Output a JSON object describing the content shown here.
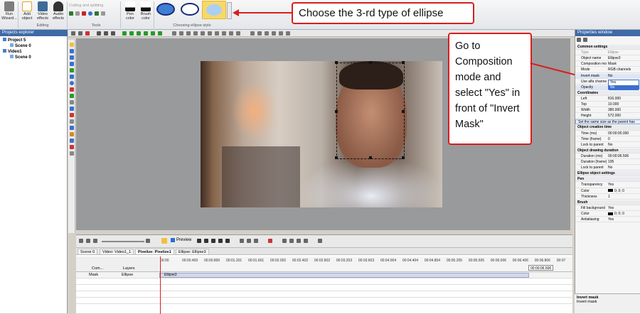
{
  "ribbon": {
    "buttons": [
      {
        "label": "Run Wizard..."
      },
      {
        "label": "Add object"
      },
      {
        "label": "Video effects"
      },
      {
        "label": "Audio effects"
      },
      {
        "label": "Pen color"
      },
      {
        "label": "Brush color"
      }
    ],
    "cutting_label": "Cutting and splitting",
    "groups": [
      "Editing",
      "Tools",
      "Choosing ellipse style"
    ]
  },
  "callouts": {
    "top": "Choose the 3-rd type of ellipse",
    "right": "Go to Composition mode and select \"Yes\" in front of \"Invert Mask\""
  },
  "explorer": {
    "title": "Projects explorer",
    "items": [
      {
        "label": "Project 5",
        "indent": 0
      },
      {
        "label": "Scene 0",
        "indent": 1
      },
      {
        "label": "Video1",
        "indent": 0
      },
      {
        "label": "Scene 0",
        "indent": 1
      }
    ]
  },
  "properties": {
    "title": "Properties window",
    "rows": [
      {
        "name": "Common settings",
        "value": "",
        "section": true
      },
      {
        "name": "Type",
        "value": "Ellipse",
        "dim": true
      },
      {
        "name": "Object name",
        "value": "Ellipse3"
      },
      {
        "name": "Composition mode",
        "value": "Mask"
      },
      {
        "name": "Mode",
        "value": "RGB channels"
      },
      {
        "name": "Invert mask",
        "value": "No",
        "highlight": true
      },
      {
        "name": "Use alfa channel",
        "value": "Yes"
      },
      {
        "name": "Opacity",
        "value": "No",
        "highlight": true
      },
      {
        "name": "Coordinates",
        "value": "",
        "section": true
      },
      {
        "name": "Left",
        "value": "816.000"
      },
      {
        "name": "Top",
        "value": "10.000"
      },
      {
        "name": "Width",
        "value": "380.000"
      },
      {
        "name": "Height",
        "value": "572.000"
      },
      {
        "name": "Set the same size as the parent has",
        "value": "",
        "note": true
      },
      {
        "name": "Object creation time",
        "value": "",
        "section": true
      },
      {
        "name": "Time (ms)",
        "value": "00:00:00.000"
      },
      {
        "name": "Time (frame)",
        "value": "0"
      },
      {
        "name": "Lock to parent",
        "value": "No"
      },
      {
        "name": "Object drawing duration",
        "value": "",
        "section": true
      },
      {
        "name": "Duration (ms)",
        "value": "00:00:06.506"
      },
      {
        "name": "Duration (frame)",
        "value": "195"
      },
      {
        "name": "Lock to parent",
        "value": "No"
      },
      {
        "name": "Ellipse object settings",
        "value": "",
        "section": true
      },
      {
        "name": "Pen",
        "value": "",
        "section": true
      },
      {
        "name": "Transparency",
        "value": "Yes"
      },
      {
        "name": "Color",
        "value": "0; 0; 0",
        "swatch": "#000000"
      },
      {
        "name": "Thickness",
        "value": "1"
      },
      {
        "name": "Brush",
        "value": "",
        "section": true
      },
      {
        "name": "Fill background",
        "value": "Yes"
      },
      {
        "name": "Color",
        "value": "0; 0; 0",
        "swatch": "#000000"
      },
      {
        "name": "Antialiasing",
        "value": "Yes"
      }
    ]
  },
  "timeline": {
    "preview_label": "Preview",
    "tabs": [
      "Scene 0",
      "Video: Video1_1",
      "Pixelize: Pixelize1",
      "Ellipse: Ellipse3"
    ],
    "ticks": [
      "00:00",
      "00:00.400",
      "00:00.800",
      "00:01.201",
      "00:01.601",
      "00:02.002",
      "00:02.402",
      "00:02.802",
      "00:03.203",
      "00:03.603",
      "00:04.004",
      "00:04.404",
      "00:04.804",
      "00:05.205",
      "00:05.605",
      "00:06.006",
      "00:06.406",
      "00:06.806",
      "00:07"
    ],
    "end_time": "00:00:06.506",
    "track_headers": [
      "Com...",
      "Layers"
    ],
    "tracks": [
      {
        "mode": "Mask",
        "layer": "Ellipse",
        "clip": "Ellipse3"
      }
    ]
  },
  "status": {
    "title": "Invert mask",
    "desc": "Invert mask"
  }
}
